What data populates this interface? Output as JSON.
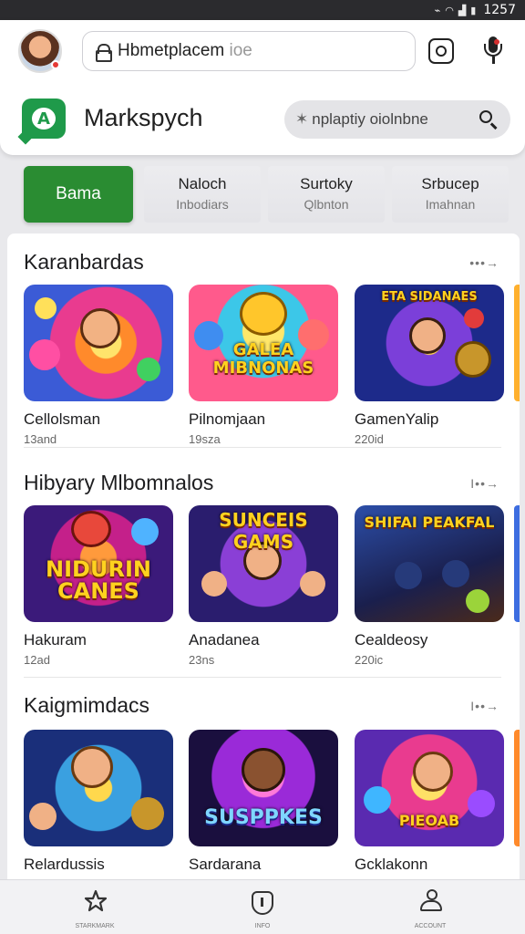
{
  "status_bar": {
    "icons": [
      "silent-icon",
      "wifi-icon",
      "signal-icon",
      "battery-icon"
    ],
    "time": "1257"
  },
  "header": {
    "url_text": "Hbmetplacem",
    "url_text_faded": " ioe",
    "app_name": "Markspych",
    "search_placeholder": "nplaptiy oiolnbne",
    "brand_color": "#2a8c32"
  },
  "tabs": {
    "active": "Bama",
    "items": [
      {
        "label": "Naloch",
        "sub": "Inbodiars"
      },
      {
        "label": "Surtoky",
        "sub": "Qlbnton"
      },
      {
        "label": "Srbucep",
        "sub": "Imahnan"
      }
    ]
  },
  "sections": [
    {
      "title": "Karanbardas",
      "more": "•••→",
      "cards": [
        {
          "name": "Cellolsman",
          "sub": "13and",
          "art_text": ""
        },
        {
          "name": "Pilnomjaan",
          "sub": "19sza",
          "art_text": "GALEA MIBNONAS"
        },
        {
          "name": "GamenYalip",
          "sub": "220id",
          "art_text": "ETA SIDANAES"
        }
      ]
    },
    {
      "title": "Hibyary Mlbomnalos",
      "more": "I••→",
      "cards": [
        {
          "name": "Hakuram",
          "sub": "12ad",
          "art_text": "NIDURIN CANES"
        },
        {
          "name": "Anadanea",
          "sub": "23ns",
          "art_text": "SUNCEIS GAMS"
        },
        {
          "name": "Cealdeosy",
          "sub": "220ic",
          "art_text": "SHIFAI PEAKFAL"
        }
      ]
    },
    {
      "title": "Kaigmimdacs",
      "more": "I••→",
      "cards": [
        {
          "name": "Relardussis",
          "sub": "",
          "art_text": ""
        },
        {
          "name": "Sardarana",
          "sub": "",
          "art_text": "SUSPPKES"
        },
        {
          "name": "Gcklakonn",
          "sub": "",
          "art_text": "PIEOAB"
        }
      ]
    }
  ],
  "bottom_nav": [
    {
      "icon": "star-icon",
      "label": "STARKMARK"
    },
    {
      "icon": "shield-icon",
      "label": "INFO"
    },
    {
      "icon": "user-icon",
      "label": "ACCOUNT"
    }
  ]
}
